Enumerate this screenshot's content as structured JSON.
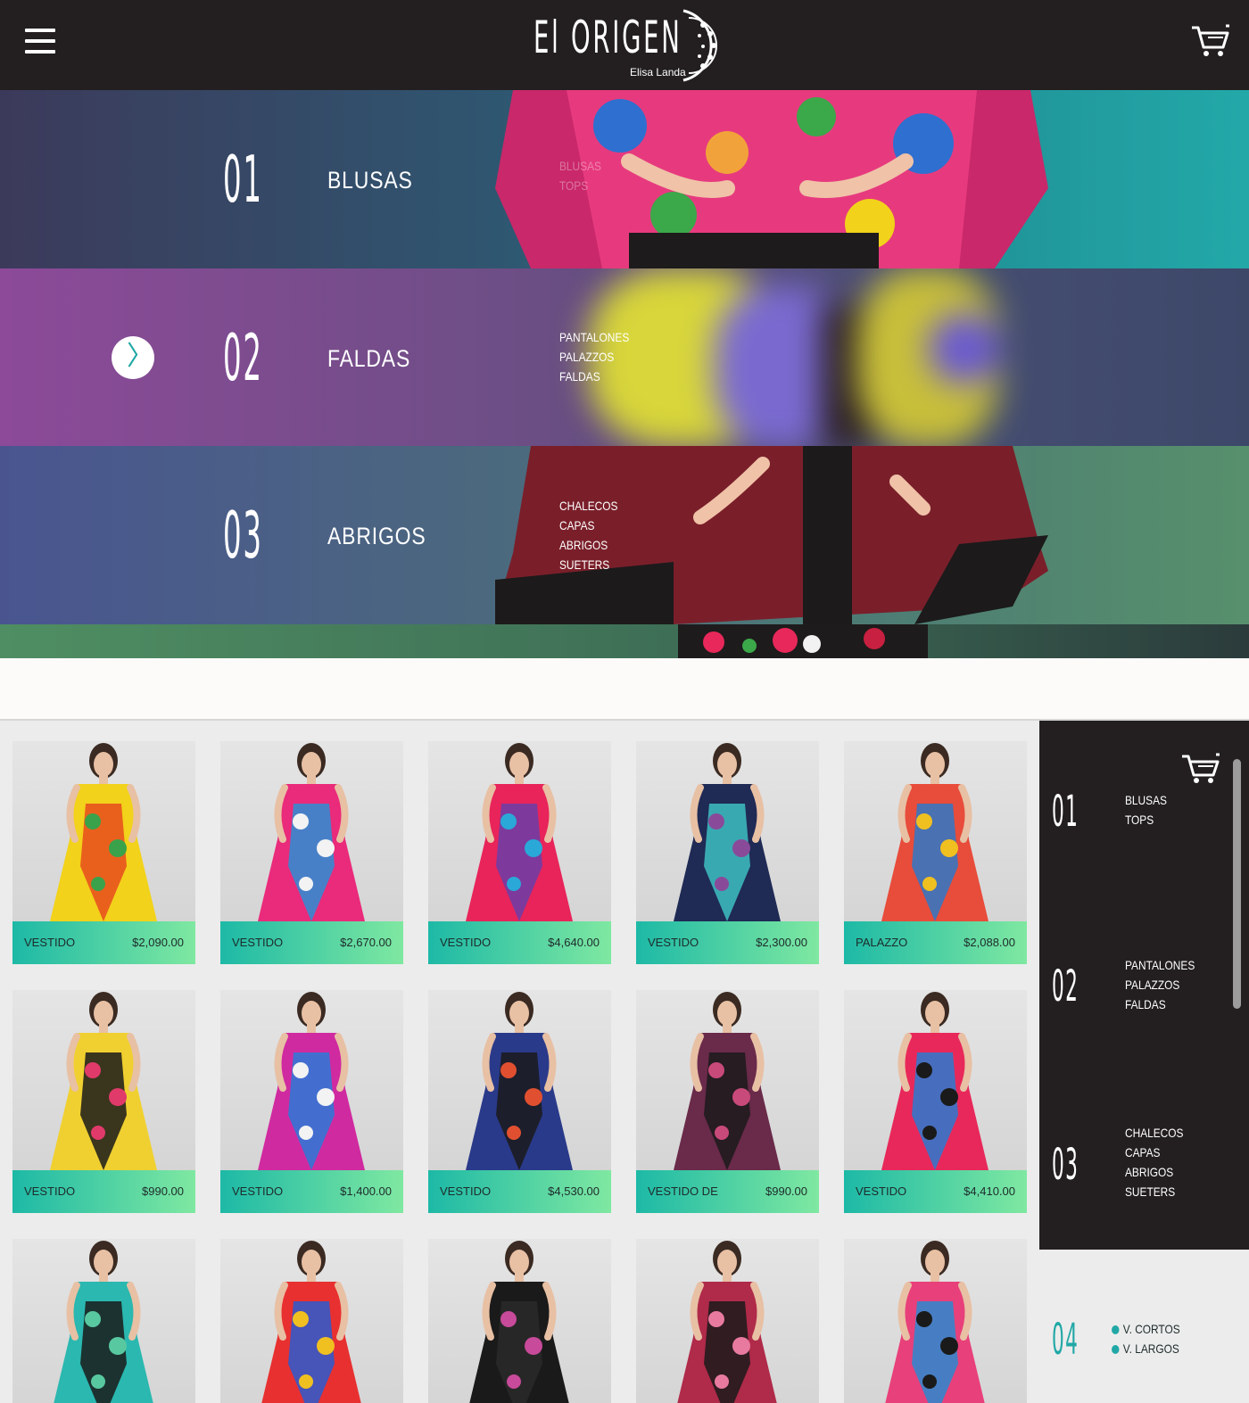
{
  "header": {
    "logo_main": "El ORIGEN",
    "logo_sub": "Elisa Landa"
  },
  "banners": [
    {
      "number": "01",
      "title": "BLUSAS",
      "subcategories": [
        "BLUSAS",
        "TOPS"
      ]
    },
    {
      "number": "02",
      "title": "FALDAS",
      "subcategories": [
        "PANTALONES",
        "PALAZZOS",
        "FALDAS"
      ],
      "arrow": "〉"
    },
    {
      "number": "03",
      "title": "ABRIGOS",
      "subcategories": [
        "CHALECOS",
        "CAPAS",
        "ABRIGOS",
        "SUETERS"
      ]
    }
  ],
  "products": [
    {
      "name": "VESTIDO",
      "price": "$2,090.00",
      "palette": [
        "#f2d21a",
        "#e84c1e",
        "#3aa24a"
      ]
    },
    {
      "name": "VESTIDO",
      "price": "$2,670.00",
      "palette": [
        "#ea2a7a",
        "#2c8fd6",
        "#f3f3f3"
      ]
    },
    {
      "name": "VESTIDO",
      "price": "$4,640.00",
      "palette": [
        "#e8245a",
        "#6a3ea8",
        "#2aa8d8"
      ]
    },
    {
      "name": "VESTIDO",
      "price": "$2,300.00",
      "palette": [
        "#1f2a55",
        "#3ec0c2",
        "#8a4a9a"
      ]
    },
    {
      "name": "PALAZZO",
      "price": "$2,088.00",
      "palette": [
        "#e84c3a",
        "#2e78c8",
        "#f0c020"
      ]
    },
    {
      "name": "VESTIDO",
      "price": "$990.00",
      "palette": [
        "#f0d030",
        "#1a1a1a",
        "#e03a6a"
      ]
    },
    {
      "name": "VESTIDO",
      "price": "$1,400.00",
      "palette": [
        "#d02aa0",
        "#2a7ad8",
        "#f3f3f3"
      ]
    },
    {
      "name": "VESTIDO",
      "price": "$4,530.00",
      "palette": [
        "#2a3a8a",
        "#1a1a1a",
        "#e05030"
      ]
    },
    {
      "name": "VESTIDO DE",
      "price": "$990.00",
      "palette": [
        "#6a2a4a",
        "#1a1a1a",
        "#c84a7a"
      ]
    },
    {
      "name": "VESTIDO",
      "price": "$4,410.00",
      "palette": [
        "#e8285a",
        "#2a7ad0",
        "#1a1a1a"
      ]
    },
    {
      "name": "",
      "price": "",
      "palette": [
        "#2ab8b0",
        "#1a1a1a",
        "#58c8a0"
      ]
    },
    {
      "name": "",
      "price": "",
      "palette": [
        "#e83030",
        "#2a5ad0",
        "#f0c020"
      ]
    },
    {
      "name": "",
      "price": "",
      "palette": [
        "#1a1a1a",
        "#2a2a2a",
        "#c84a9a"
      ]
    },
    {
      "name": "",
      "price": "",
      "palette": [
        "#b02a4a",
        "#1a1a1a",
        "#e87aa0"
      ]
    },
    {
      "name": "",
      "price": "",
      "palette": [
        "#e8407a",
        "#2a8ad0",
        "#1a1a1a"
      ]
    }
  ],
  "side_menu": [
    {
      "number": "01",
      "subcategories": [
        "BLUSAS",
        "TOPS"
      ]
    },
    {
      "number": "02",
      "subcategories": [
        "PANTALONES",
        "PALAZZOS",
        "FALDAS"
      ]
    },
    {
      "number": "03",
      "subcategories": [
        "CHALECOS",
        "CAPAS",
        "ABRIGOS",
        "SUETERS"
      ]
    }
  ],
  "filter": {
    "number": "04",
    "options": [
      "V. CORTOS",
      "V. LARGOS"
    ]
  },
  "colors": {
    "header_bg": "#231f20",
    "accent": "#21a8a6",
    "tag_gradient_start": "#1db9a6",
    "tag_gradient_end": "#7fe8a1"
  }
}
